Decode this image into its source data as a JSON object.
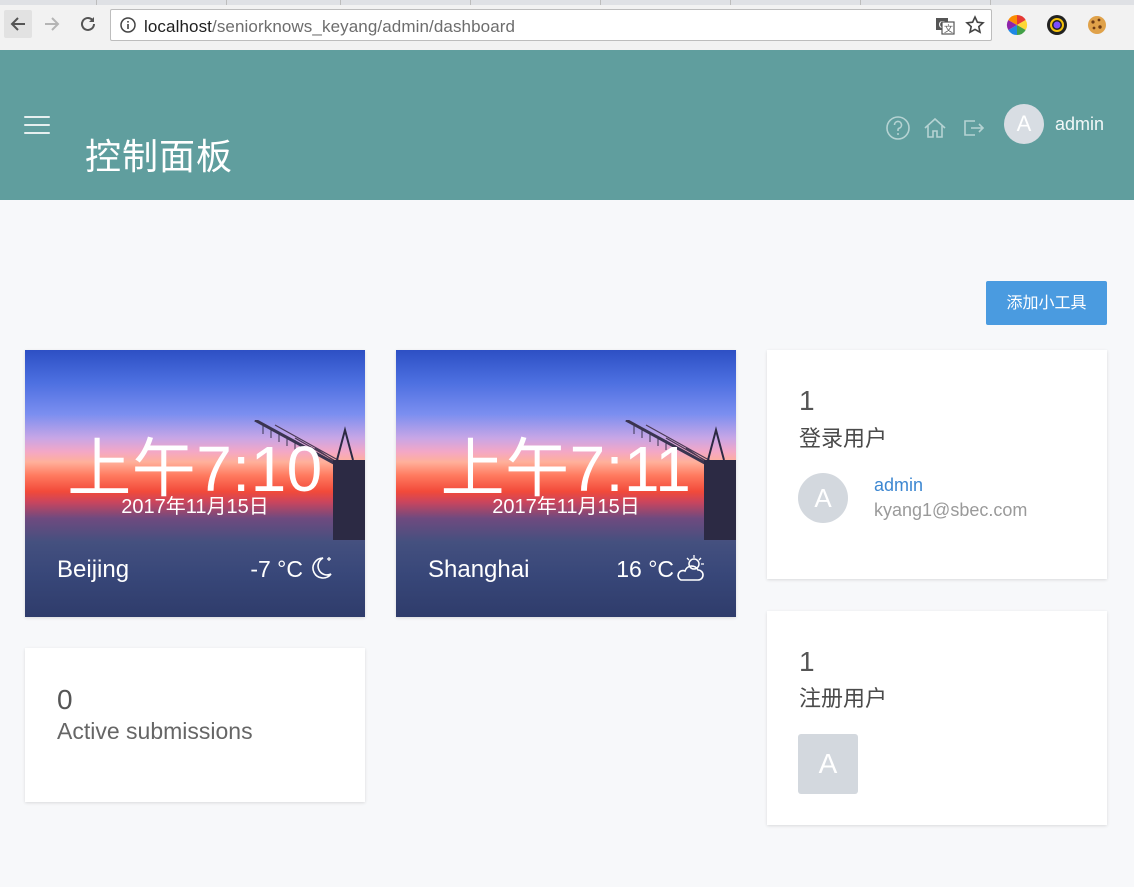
{
  "browser": {
    "url_host": "localhost",
    "url_path": "/seniorknows_keyang/admin/dashboard",
    "nav_icons": [
      "back-arrow-icon",
      "forward-arrow-icon",
      "reload-icon",
      "info-icon"
    ],
    "omnibox_icons": [
      "translate-icon",
      "bookmark-star-icon"
    ],
    "extensions": [
      "color-wheel-extension-icon",
      "camera-lens-extension-icon",
      "cookie-extension-icon"
    ]
  },
  "header": {
    "title": "控制面板",
    "icons": [
      "help-circle-icon",
      "home-icon",
      "logout-icon"
    ],
    "avatar_initial": "A",
    "username": "admin",
    "background_color": "#609e9e"
  },
  "toolbar": {
    "add_widget_label": "添加小工具",
    "accent_color": "#4a9be0"
  },
  "clocks": [
    {
      "time": "上午7:10",
      "date": "2017年11月15日",
      "city": "Beijing",
      "temperature": "-7 °C",
      "weather_icon": "moon-night-icon"
    },
    {
      "time": "上午7:11",
      "date": "2017年11月15日",
      "city": "Shanghai",
      "temperature": "16 °C",
      "weather_icon": "partly-cloudy-sun-icon"
    }
  ],
  "active_submissions": {
    "count": "0",
    "label": "Active submissions"
  },
  "logged_in_users": {
    "count": "1",
    "label": "登录用户",
    "users": [
      {
        "initial": "A",
        "name": "admin",
        "email": "kyang1@sbec.com"
      }
    ]
  },
  "registered_users": {
    "count": "1",
    "label": "注册用户",
    "users": [
      {
        "initial": "A"
      }
    ]
  }
}
